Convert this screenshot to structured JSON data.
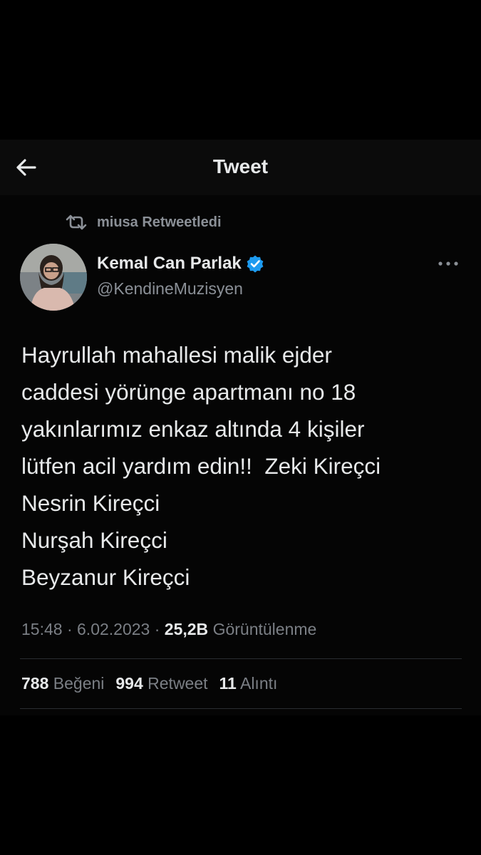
{
  "header": {
    "title": "Tweet",
    "back_icon": "arrow-left-icon"
  },
  "retweet_context": {
    "icon": "retweet-icon",
    "text": "miusa Retweetledi"
  },
  "author": {
    "name": "Kemal Can Parlak",
    "handle": "@KendineMuzisyen",
    "verified_icon": "verified-badge-icon",
    "verified_color": "#1d9bf0"
  },
  "more_icon": "more-options-icon",
  "tweet": {
    "lines": [
      "Hayrullah mahallesi malik ejder",
      "caddesi yörünge apartmanı no 18",
      "yakınlarımız enkaz altında 4 kişiler",
      "lütfen acil yardım edin!!  Zeki Kireçci",
      "Nesrin Kireçci",
      "Nurşah Kireçci",
      "Beyzanur Kireçci"
    ]
  },
  "meta": {
    "time": "15:48",
    "separator": " · ",
    "date": "6.02.2023",
    "views_count": "25,2B",
    "views_label": "Görüntülenme"
  },
  "stats": {
    "likes_count": "788",
    "likes_label": "Beğeni",
    "retweets_count": "994",
    "retweets_label": "Retweet",
    "quotes_count": "11",
    "quotes_label": "Alıntı"
  },
  "colors": {
    "background": "#000000",
    "text": "#e7e9ea",
    "secondary_text": "#8b9097",
    "accent": "#1d9bf0"
  }
}
